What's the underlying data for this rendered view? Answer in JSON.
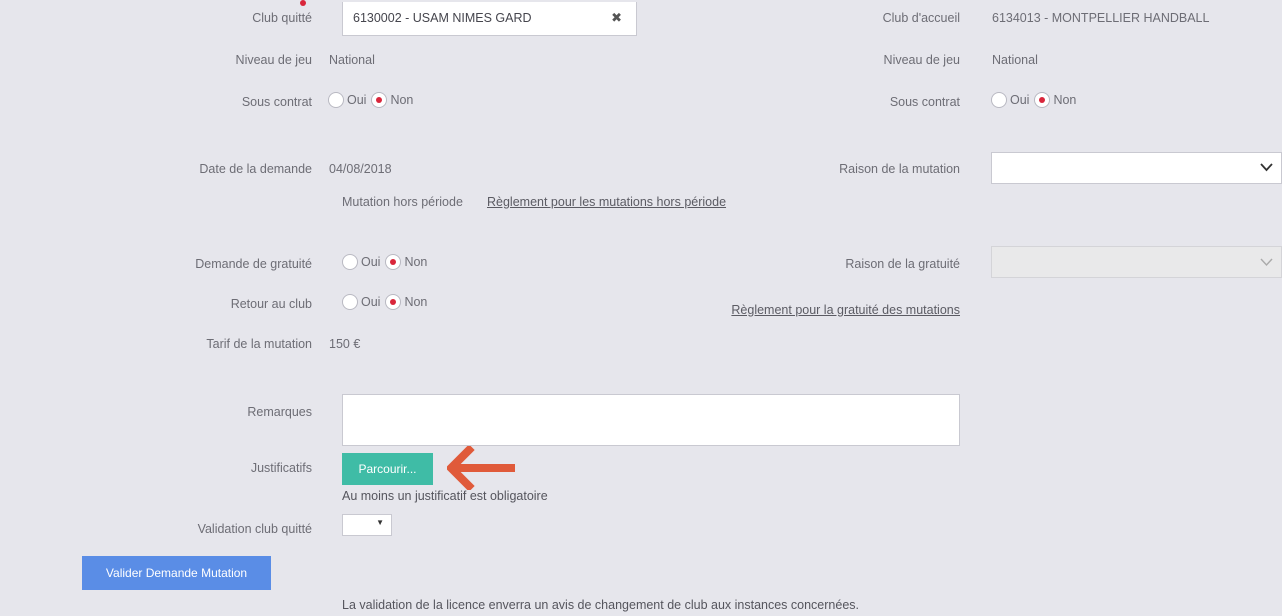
{
  "club_quitte": {
    "label": "Club quitté",
    "value": "6130002 - USAM NIMES GARD",
    "clear_icon": "close-icon"
  },
  "club_accueil": {
    "label": "Club d'accueil",
    "value": "6134013 - MONTPELLIER HANDBALL"
  },
  "niveau_left": {
    "label": "Niveau de jeu",
    "value": "National"
  },
  "niveau_right": {
    "label": "Niveau de jeu",
    "value": "National"
  },
  "contrat_left": {
    "label": "Sous contrat",
    "oui": "Oui",
    "non": "Non",
    "selected": "Non"
  },
  "contrat_right": {
    "label": "Sous contrat",
    "oui": "Oui",
    "non": "Non",
    "selected": "Non"
  },
  "date_demande": {
    "label": "Date de la demande",
    "value": "04/08/2018"
  },
  "raison_mutation": {
    "label": "Raison de la mutation",
    "value": ""
  },
  "hors_periode": {
    "text": "Mutation hors période",
    "link": "Règlement pour les mutations hors période"
  },
  "gratuite": {
    "label": "Demande de gratuité",
    "oui": "Oui",
    "non": "Non",
    "selected": "Non"
  },
  "raison_gratuite": {
    "label": "Raison de la gratuité",
    "value": ""
  },
  "retour_club": {
    "label": "Retour au club",
    "oui": "Oui",
    "non": "Non",
    "selected": "Non"
  },
  "reglement_gratuite": {
    "link": "Règlement pour la gratuité des mutations"
  },
  "tarif": {
    "label": "Tarif de la mutation",
    "value": "150 €"
  },
  "remarques": {
    "label": "Remarques",
    "value": ""
  },
  "justificatifs": {
    "label": "Justificatifs",
    "button": "Parcourir...",
    "note": "Au moins un justificatif est obligatoire"
  },
  "validation_club": {
    "label": "Validation club quitté",
    "value": ""
  },
  "submit": {
    "label": "Valider Demande Mutation"
  },
  "footer_note": "La validation de la licence enverra un avis de changement de club aux instances concernées.",
  "colors": {
    "background": "#e6e6ec",
    "teal": "#3fbca6",
    "blue": "#5a8de6",
    "radio_selected": "#d9263b",
    "arrow": "#e05a3a"
  }
}
